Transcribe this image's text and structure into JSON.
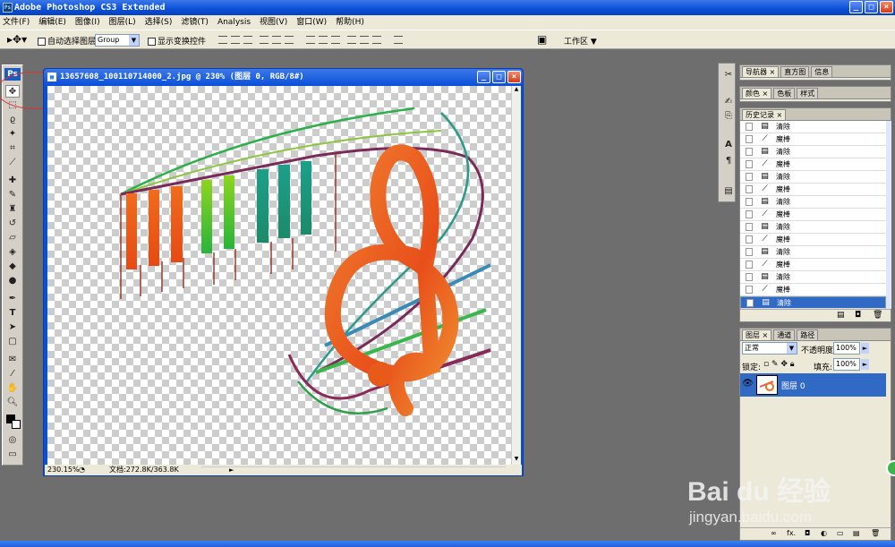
{
  "app": {
    "title": "Adobe Photoshop CS3 Extended",
    "logo": "Ps"
  },
  "menu": [
    "文件(F)",
    "编辑(E)",
    "图像(I)",
    "图层(L)",
    "选择(S)",
    "滤镜(T)",
    "Analysis",
    "视图(V)",
    "窗口(W)",
    "帮助(H)"
  ],
  "options": {
    "auto_select_label": "自动选择图层",
    "group_value": "Group",
    "show_transform_label": "显示变换控件",
    "workspace_label": "工作区"
  },
  "document": {
    "title": "13657608_100110714000_2.jpg @ 230% (图层 0, RGB/8#)",
    "zoom": "230.15%",
    "doc_size": "文档:272.8K/363.8K"
  },
  "panels": {
    "nav_tabs": [
      "导航器",
      "直方图",
      "信息"
    ],
    "color_tabs": [
      "颜色",
      "色板",
      "样式"
    ],
    "history_tab": "历史记录",
    "history": [
      {
        "label": "清除",
        "icon": "doc-icon"
      },
      {
        "label": "魔棒",
        "icon": "wand-icon"
      },
      {
        "label": "清除",
        "icon": "doc-icon"
      },
      {
        "label": "魔棒",
        "icon": "wand-icon"
      },
      {
        "label": "清除",
        "icon": "doc-icon"
      },
      {
        "label": "魔棒",
        "icon": "wand-icon"
      },
      {
        "label": "清除",
        "icon": "doc-icon"
      },
      {
        "label": "魔棒",
        "icon": "wand-icon"
      },
      {
        "label": "清除",
        "icon": "doc-icon"
      },
      {
        "label": "魔棒",
        "icon": "wand-icon"
      },
      {
        "label": "清除",
        "icon": "doc-icon"
      },
      {
        "label": "魔棒",
        "icon": "wand-icon"
      },
      {
        "label": "清除",
        "icon": "doc-icon"
      },
      {
        "label": "魔棒",
        "icon": "wand-icon"
      },
      {
        "label": "清除",
        "icon": "doc-icon"
      }
    ],
    "layer_tabs": [
      "图层",
      "通道",
      "路径"
    ],
    "blend_mode": "正常",
    "opacity_label": "不透明度:",
    "opacity": "100%",
    "lock_label": "锁定:",
    "fill_label": "填充:",
    "fill": "100%",
    "layer_name": "图层 0"
  },
  "watermark": {
    "brand": "Bai du 经验",
    "url": "jingyan.baidu.com"
  },
  "colors": {
    "accent": "#316ac5",
    "title_blue": "#0a4fd8"
  }
}
